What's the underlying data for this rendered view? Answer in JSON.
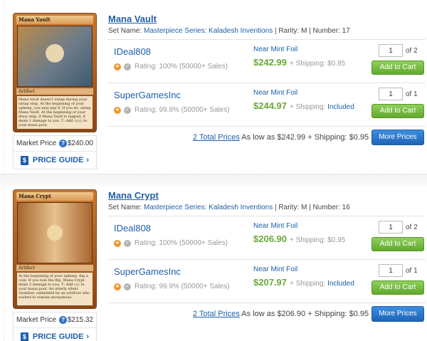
{
  "products": [
    {
      "title": "Mana Vault",
      "card_title_bar": "Mana Vault",
      "card_type": "Artifact",
      "card_text": "Mana Vault doesn't untap during your untap step. At the beginning of your upkeep, you may pay 4. If you do, untap Mana Vault. At the beginning of your draw step, if Mana Vault is tapped, it deals 1 damage to you. T: Add ◇◇◇ to your mana pool.",
      "set_label": "Set Name:",
      "set_name": "Masterpiece Series: Kaladesh Inventions",
      "rarity": "| Rarity: M | Number: 17",
      "market_label": "Market Price",
      "market_value": "$240.00",
      "guide_label": "PRICE GUIDE",
      "listings": [
        {
          "seller": "IDeal808",
          "rating": "Rating: 100% (50000+ Sales)",
          "condition": "Near Mint Foil",
          "price": "$242.99",
          "shipping_label": "+ Shipping:",
          "shipping_value": "$0.95",
          "shipping_included": false,
          "qty": "1",
          "qty_of": "of 2",
          "cart_label": "Add to Cart"
        },
        {
          "seller": "SuperGamesInc",
          "rating": "Rating: 99.9% (50000+ Sales)",
          "condition": "Near Mint Foil",
          "price": "$244.97",
          "shipping_label": "+ Shipping:",
          "shipping_value": "Included",
          "shipping_included": true,
          "qty": "1",
          "qty_of": "of 1",
          "cart_label": "Add to Cart"
        }
      ],
      "summary_link": "2 Total Prices",
      "summary_text": "As low as $242.99 + Shipping: $0.95",
      "more_label": "More Prices"
    },
    {
      "title": "Mana Crypt",
      "card_title_bar": "Mana Crypt",
      "card_type": "Artifact",
      "card_text": "At the beginning of your upkeep, flip a coin. If you lose the flip, Mana Crypt deals 3 damage to you. T: Add ◇◇ to your mana pool. An utterly silent chamber, submitted by an artificer who wished to remain anonymous.",
      "set_label": "Set Name:",
      "set_name": "Masterpiece Series: Kaladesh Inventions",
      "rarity": "| Rarity: M | Number: 16",
      "market_label": "Market Price",
      "market_value": "$215.32",
      "guide_label": "PRICE GUIDE",
      "listings": [
        {
          "seller": "IDeal808",
          "rating": "Rating: 100% (50000+ Sales)",
          "condition": "Near Mint Foil",
          "price": "$206.90",
          "shipping_label": "+ Shipping:",
          "shipping_value": "$0.95",
          "shipping_included": false,
          "qty": "1",
          "qty_of": "of 2",
          "cart_label": "Add to Cart"
        },
        {
          "seller": "SuperGamesInc",
          "rating": "Rating: 99.9% (50000+ Sales)",
          "condition": "Near Mint Foil",
          "price": "$207.97",
          "shipping_label": "+ Shipping:",
          "shipping_value": "Included",
          "shipping_included": true,
          "qty": "1",
          "qty_of": "of 1",
          "cart_label": "Add to Cart"
        }
      ],
      "summary_link": "2 Total Prices",
      "summary_text": "As low as $206.90 + Shipping: $0.95",
      "more_label": "More Prices"
    }
  ],
  "icons": {
    "help": "?",
    "guide": "$",
    "chevron": "›",
    "seller_badge": "★",
    "verified_badge": "✓"
  },
  "colors": {
    "link_blue": "#1f5fa8",
    "price_green": "#6aa83a",
    "cart_green": "#62a92e",
    "more_blue": "#1f64b8",
    "badge_orange": "#f0962b"
  }
}
